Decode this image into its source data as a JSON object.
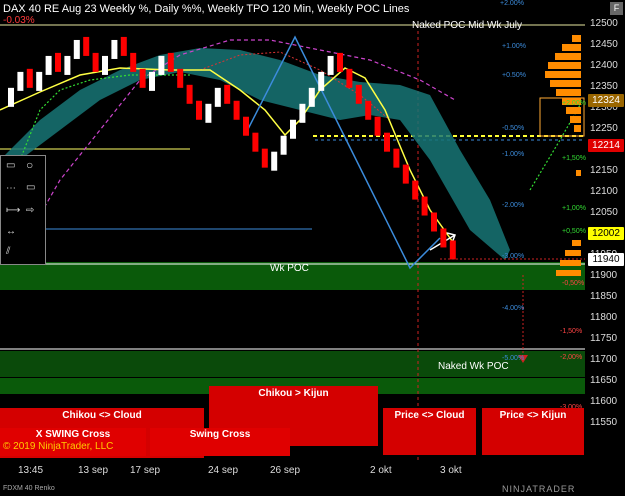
{
  "header": {
    "title": "DAX 40 RE Aug 23 Weekly %, Daily %%, Weekly TPO 120 Min, Weekly POC Lines",
    "change": "-0.03%",
    "f_button": "F"
  },
  "labels": {
    "naked_poc_mid_wk_july": "Naked POC Mid Wk July",
    "wk_poc": "Wk POC",
    "naked_wk_poc": "Naked Wk POC"
  },
  "buttons": {
    "chikou_kijun": "Chikou > Kijun",
    "chikou_cloud": "Chikou <> Cloud",
    "x_swing_cross": "X SWING Cross",
    "swing_cross": "Swing Cross",
    "price_cloud": "Price <> Cloud",
    "price_kijun": "Price <> Kijun"
  },
  "y_axis": [
    "12500",
    "12450",
    "12400",
    "12350",
    "12300",
    "12250",
    "12200",
    "12150",
    "12100",
    "12050",
    "12000",
    "11950",
    "11900",
    "11850",
    "11800",
    "11750",
    "11700",
    "11650",
    "11600",
    "11550"
  ],
  "x_axis": [
    "13:45",
    "13 sep",
    "17 sep",
    "24 sep",
    "26 sep",
    "2 okt",
    "3 okt"
  ],
  "price_tags": {
    "t1": "12324",
    "t2": "12214",
    "t3": "12002",
    "t4": "11940"
  },
  "percent_labels_left": [
    "+2.00%",
    "+1.00%",
    "+0.50%",
    "-0.50%",
    "-1.00%",
    "-2.00%",
    "-3.00%",
    "-4.00%",
    "-5.00%"
  ],
  "percent_labels_right": [
    "+2.00%",
    "+1,50%",
    "+1,00%",
    "+0,50%",
    "-0,50%",
    "-1,50%",
    "-2,00%",
    "-3,00%"
  ],
  "copyright": "© 2019 NinjaTrader, LLC",
  "instrument": "FDXM 40 Renko",
  "brand": "NINJATRADER",
  "colors": {
    "up_bar": "#ffffff",
    "down_bar": "#ff0000",
    "cloud": "#1a8a8a",
    "poc_band": "#0a5a0a",
    "button_red": "#d40000",
    "tag_red": "#e00000",
    "tag_yellow": "#ffff00"
  },
  "chart_data": {
    "type": "renko",
    "instrument": "FDXM 40 Renko",
    "y_range": [
      11520,
      12520
    ],
    "bricks": [
      {
        "dir": "up",
        "value": 12370
      },
      {
        "dir": "up",
        "value": 12410
      },
      {
        "dir": "down",
        "value": 12370
      },
      {
        "dir": "up",
        "value": 12410
      },
      {
        "dir": "up",
        "value": 12450
      },
      {
        "dir": "down",
        "value": 12410
      },
      {
        "dir": "up",
        "value": 12450
      },
      {
        "dir": "up",
        "value": 12490
      },
      {
        "dir": "down",
        "value": 12450
      },
      {
        "dir": "down",
        "value": 12410
      },
      {
        "dir": "up",
        "value": 12450
      },
      {
        "dir": "up",
        "value": 12490
      },
      {
        "dir": "down",
        "value": 12450
      },
      {
        "dir": "down",
        "value": 12410
      },
      {
        "dir": "down",
        "value": 12370
      },
      {
        "dir": "up",
        "value": 12410
      },
      {
        "dir": "up",
        "value": 12450
      },
      {
        "dir": "down",
        "value": 12410
      },
      {
        "dir": "down",
        "value": 12370
      },
      {
        "dir": "down",
        "value": 12330
      },
      {
        "dir": "down",
        "value": 12290
      },
      {
        "dir": "up",
        "value": 12330
      },
      {
        "dir": "up",
        "value": 12370
      },
      {
        "dir": "down",
        "value": 12330
      },
      {
        "dir": "down",
        "value": 12290
      },
      {
        "dir": "down",
        "value": 12250
      },
      {
        "dir": "down",
        "value": 12210
      },
      {
        "dir": "down",
        "value": 12170
      },
      {
        "dir": "up",
        "value": 12210
      },
      {
        "dir": "up",
        "value": 12250
      },
      {
        "dir": "up",
        "value": 12290
      },
      {
        "dir": "up",
        "value": 12330
      },
      {
        "dir": "up",
        "value": 12370
      },
      {
        "dir": "up",
        "value": 12410
      },
      {
        "dir": "up",
        "value": 12450
      },
      {
        "dir": "down",
        "value": 12410
      },
      {
        "dir": "down",
        "value": 12370
      },
      {
        "dir": "down",
        "value": 12330
      },
      {
        "dir": "down",
        "value": 12290
      },
      {
        "dir": "down",
        "value": 12250
      },
      {
        "dir": "down",
        "value": 12210
      },
      {
        "dir": "down",
        "value": 12170
      },
      {
        "dir": "down",
        "value": 12130
      },
      {
        "dir": "down",
        "value": 12090
      },
      {
        "dir": "down",
        "value": 12050
      },
      {
        "dir": "down",
        "value": 12010
      },
      {
        "dir": "down",
        "value": 11970
      },
      {
        "dir": "down",
        "value": 11940
      }
    ]
  }
}
